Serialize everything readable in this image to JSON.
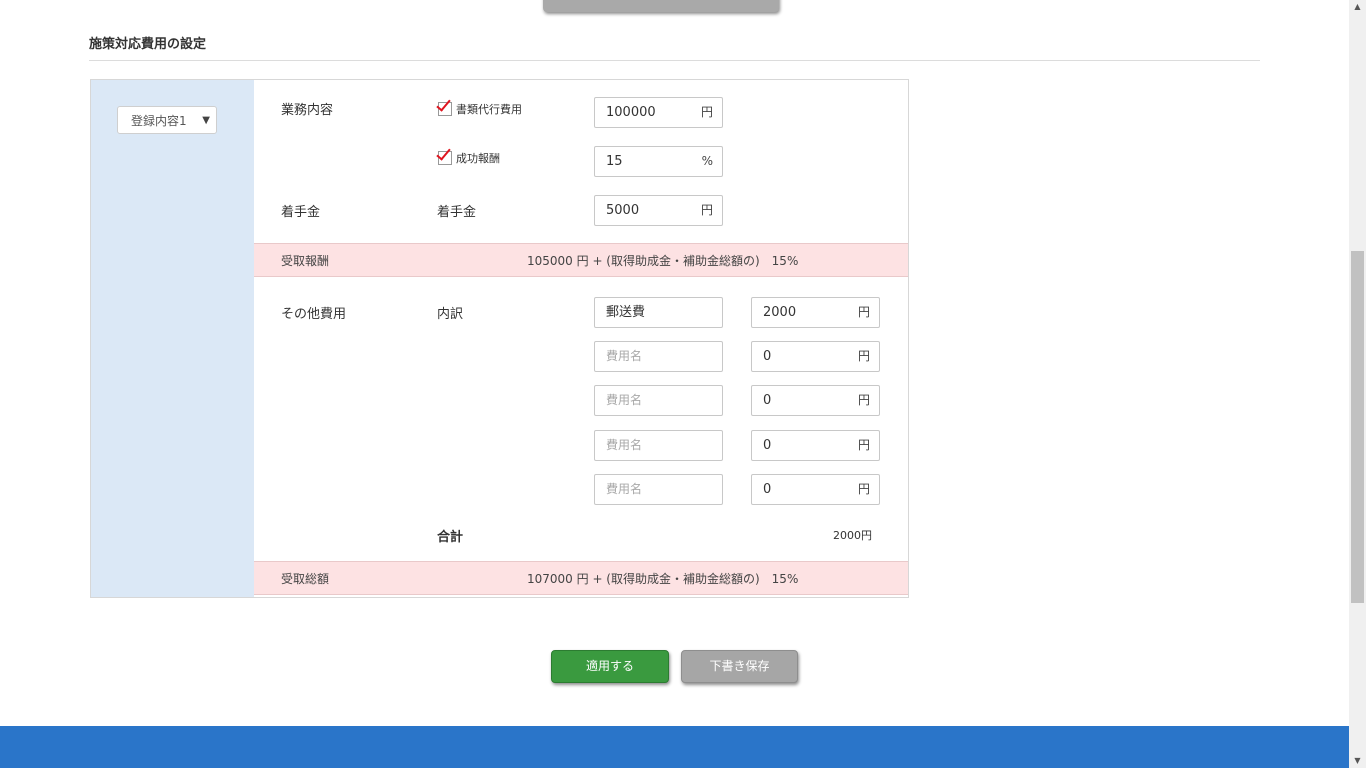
{
  "section": {
    "title": "施策対応費用の設定"
  },
  "sidebar": {
    "selected_option": "登録内容1"
  },
  "work": {
    "label": "業務内容",
    "doc_fee": {
      "label": "書類代行費用",
      "checked": true,
      "value": "100000",
      "unit": "円"
    },
    "success_fee": {
      "label": "成功報酬",
      "checked": true,
      "value": "15",
      "unit": "%"
    }
  },
  "retainer": {
    "label": "着手金",
    "sublabel": "着手金",
    "value": "5000",
    "unit": "円"
  },
  "receipt": {
    "label": "受取報酬",
    "value": "105000 円 + (取得助成金・補助金総額の)　15%"
  },
  "other": {
    "label": "その他費用",
    "sublabel": "内訳",
    "rows": [
      {
        "name": "郵送費",
        "amount": "2000",
        "unit": "円"
      },
      {
        "name_placeholder": "費用名",
        "amount": "0",
        "unit": "円"
      },
      {
        "name_placeholder": "費用名",
        "amount": "0",
        "unit": "円"
      },
      {
        "name_placeholder": "費用名",
        "amount": "0",
        "unit": "円"
      },
      {
        "name_placeholder": "費用名",
        "amount": "0",
        "unit": "円"
      }
    ],
    "total_label": "合計",
    "total_value": "2000円"
  },
  "total": {
    "label": "受取総額",
    "value": "107000 円 + (取得助成金・補助金総額の)　15%"
  },
  "buttons": {
    "apply": "適用する",
    "draft": "下書き保存"
  },
  "colors": {
    "apply": "#3a9a3f",
    "draft": "#a6a6a6",
    "footer": "#2a75c9",
    "band": "#fde2e3",
    "sidebar": "#dbe8f6",
    "check": "#e0141e"
  },
  "icons": {
    "select_arrow": "▼",
    "scroll_up": "▲",
    "scroll_down": "▼"
  }
}
